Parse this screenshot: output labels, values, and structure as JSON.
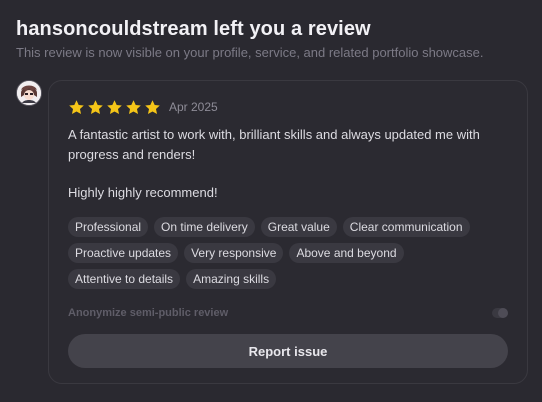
{
  "header": {
    "title": "hansoncouldstream left you a review",
    "subtitle": "This review is now visible on your profile, service, and related portfolio showcase."
  },
  "review": {
    "rating": 5,
    "max_rating": 5,
    "star_color": "#f5c518",
    "date": "Apr 2025",
    "text_line1": "A fantastic artist to work with, brilliant skills and always updated me with",
    "text_line2": "progress and renders!",
    "text_line3": "Highly highly recommend!",
    "tags": [
      "Professional",
      "On time delivery",
      "Great value",
      "Clear communication",
      "Proactive updates",
      "Very responsive",
      "Above and beyond",
      "Attentive to details",
      "Amazing skills"
    ]
  },
  "settings": {
    "anonymize_label": "Anonymize semi-public review",
    "anonymize_enabled": false
  },
  "actions": {
    "report_label": "Report issue"
  },
  "icons": {
    "avatar": "reviewer-avatar",
    "star": "star-icon",
    "toggle": "toggle-switch"
  }
}
